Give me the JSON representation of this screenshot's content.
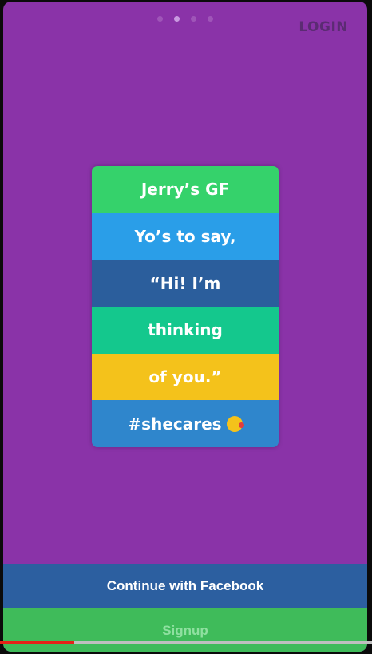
{
  "pagination": {
    "count": 4,
    "active_index": 1
  },
  "header": {
    "login_label": "LOGIN"
  },
  "card": {
    "rows": [
      {
        "text": "Jerry’s GF",
        "color": "#35d26b"
      },
      {
        "text": "Yo’s to say,",
        "color": "#2a9ee8"
      },
      {
        "text": "“Hi! I’m",
        "color": "#2b5e9c"
      },
      {
        "text": "thinking",
        "color": "#14c88d"
      },
      {
        "text": "of you.”",
        "color": "#f4c21b"
      },
      {
        "text": "#shecares",
        "color": "#2f86cc",
        "emoji": "kiss-face-icon"
      }
    ]
  },
  "actions": {
    "facebook_label": "Continue with Facebook",
    "signup_label": "Signup"
  },
  "video_progress": {
    "fraction": 0.2
  },
  "colors": {
    "background": "#8a33a8",
    "facebook": "#2c5fa0",
    "signup": "#3fbb5a",
    "progress": "#e52218"
  }
}
